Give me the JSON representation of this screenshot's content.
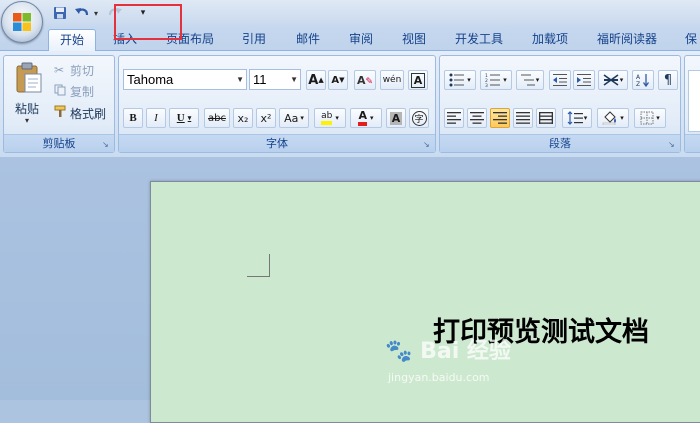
{
  "tabs": [
    "开始",
    "插入",
    "页面布局",
    "引用",
    "邮件",
    "审阅",
    "视图",
    "开发工具",
    "加载项",
    "福昕阅读器",
    "保"
  ],
  "clipboard": {
    "paste_label": "粘贴",
    "cut_label": "剪切",
    "copy_label": "复制",
    "format_painter_label": "格式刷",
    "group_label": "剪贴板"
  },
  "font": {
    "font_name": "Tahoma",
    "font_size": "11",
    "group_label": "字体",
    "bold": "B",
    "italic": "I",
    "underline": "U",
    "strikethrough": "abc",
    "subscript": "x₂",
    "superscript": "x²",
    "change_case": "Aa",
    "char_border": "A",
    "highlight": "ab",
    "font_color": "A",
    "char_shading": "A",
    "enclose": "字",
    "grow": "A",
    "shrink": "A",
    "clear": "A",
    "phonetic": "wén"
  },
  "paragraph": {
    "group_label": "段落"
  },
  "document": {
    "text": "打印预览测试文档"
  },
  "watermark": {
    "brand": "Bai 经验",
    "url": "jingyan.baidu.com"
  },
  "colors": {
    "page_background": "#cce8cf",
    "highlight_box": "#e3313d",
    "tab_text": "#15428b"
  }
}
